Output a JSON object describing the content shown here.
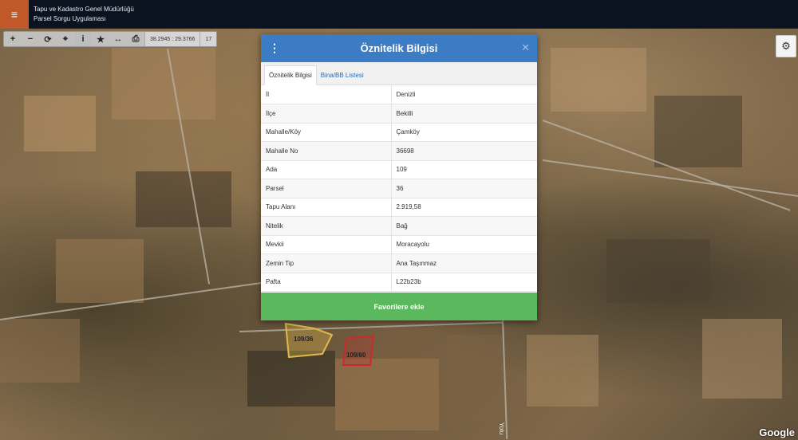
{
  "header": {
    "title_line1": "Tapu ve Kadastro Genel Müdürlüğü",
    "title_line2": "Parsel Sorgu Uygulaması",
    "menu_icon": "hamburger-icon"
  },
  "toolbar": {
    "coords": "38.2945 : 29.3766",
    "zoom": "17",
    "icons": [
      "zoom-in-icon",
      "zoom-out-icon",
      "refresh-icon",
      "locate-icon",
      "info-icon",
      "star-icon",
      "measure-icon",
      "print-icon"
    ]
  },
  "map": {
    "parcels": [
      {
        "label": "109/36",
        "highlight": "#e0b84a"
      },
      {
        "label": "109/60",
        "highlight": "#cc2a2a"
      }
    ],
    "road_label": "Yolu",
    "attribution": "Google"
  },
  "dialog": {
    "title": "Öznitelik Bilgisi",
    "tabs": [
      {
        "label": "Öznitelik Bilgisi",
        "active": true
      },
      {
        "label": "Bina/BB Listesi",
        "active": false
      }
    ],
    "rows": [
      {
        "key": "İl",
        "value": "Denizli"
      },
      {
        "key": "İlçe",
        "value": "Bekilli"
      },
      {
        "key": "Mahalle/Köy",
        "value": "Çamköy"
      },
      {
        "key": "Mahalle No",
        "value": "36698"
      },
      {
        "key": "Ada",
        "value": "109"
      },
      {
        "key": "Parsel",
        "value": "36"
      },
      {
        "key": "Tapu Alanı",
        "value": "2.919,58"
      },
      {
        "key": "Nitelik",
        "value": "Bağ"
      },
      {
        "key": "Mevkii",
        "value": "Moracayolu"
      },
      {
        "key": "Zemin Tip",
        "value": "Ana Taşınmaz"
      },
      {
        "key": "Pafta",
        "value": "L22b23b"
      }
    ],
    "favorite_button": "Favorilere ekle",
    "header_color": "#3c7cc4",
    "button_color": "#5cb85c"
  }
}
